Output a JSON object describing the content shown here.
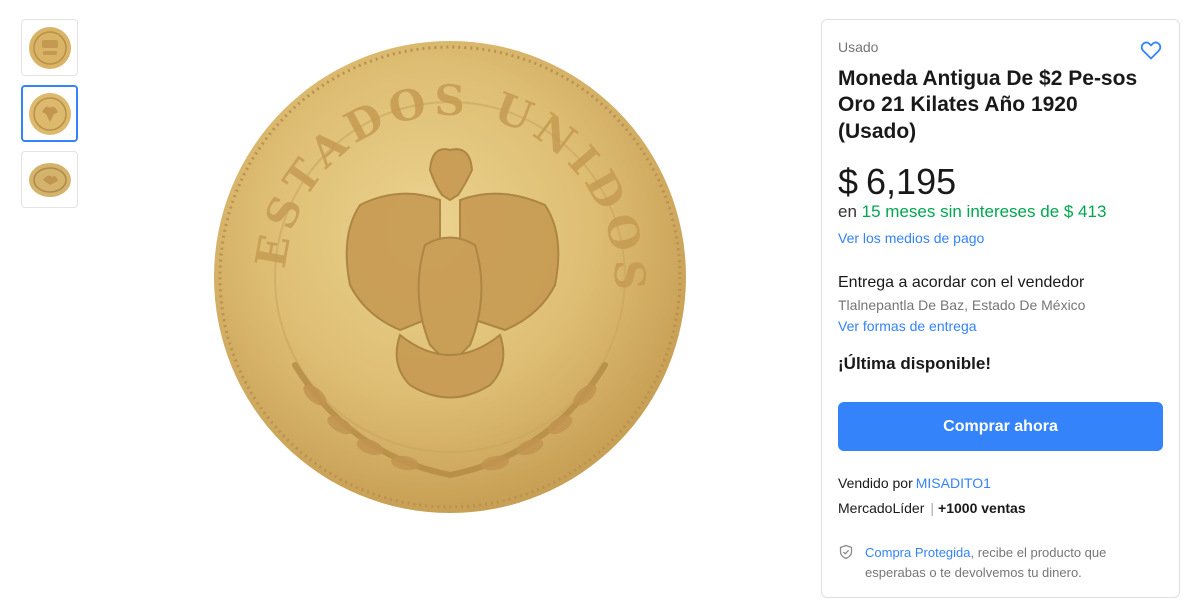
{
  "gallery": {
    "thumbnails": [
      {
        "name": "coin-front-thumbnail",
        "active": false
      },
      {
        "name": "coin-eagle-thumbnail",
        "active": true
      },
      {
        "name": "coin-angle-thumbnail",
        "active": false
      }
    ],
    "main_image": "gold-coin-eagle-side"
  },
  "product": {
    "condition": "Usado",
    "title": "Moneda Antigua De $2 Pe-sos Oro 21 Kilates Año 1920 (Usado)",
    "price_currency": "$",
    "price_amount": "6,195",
    "installments_prefix": "en",
    "installments_text": "15 meses sin intereses de $ 413",
    "payment_link": "Ver los medios de pago",
    "delivery_text": "Entrega a acordar con el vendedor",
    "location": "Tlalnepantla De Baz, Estado De México",
    "delivery_link": "Ver formas de entrega",
    "stock_text": "¡Última disponible!",
    "buy_button": "Comprar ahora",
    "seller_prefix": "Vendido por",
    "seller_name": "MISADITO1",
    "seller_level": "MercadoLíder",
    "seller_separator": "|",
    "seller_sales": "+1000 ventas",
    "protection_link": "Compra Protegida",
    "protection_text": ", recibe el producto que esperabas o te devolvemos tu dinero."
  },
  "colors": {
    "accent": "#3483fa",
    "green": "#00a650",
    "gold": "#d6b267"
  },
  "icons": {
    "favorite": "heart-icon",
    "protection": "shield-check-icon"
  }
}
